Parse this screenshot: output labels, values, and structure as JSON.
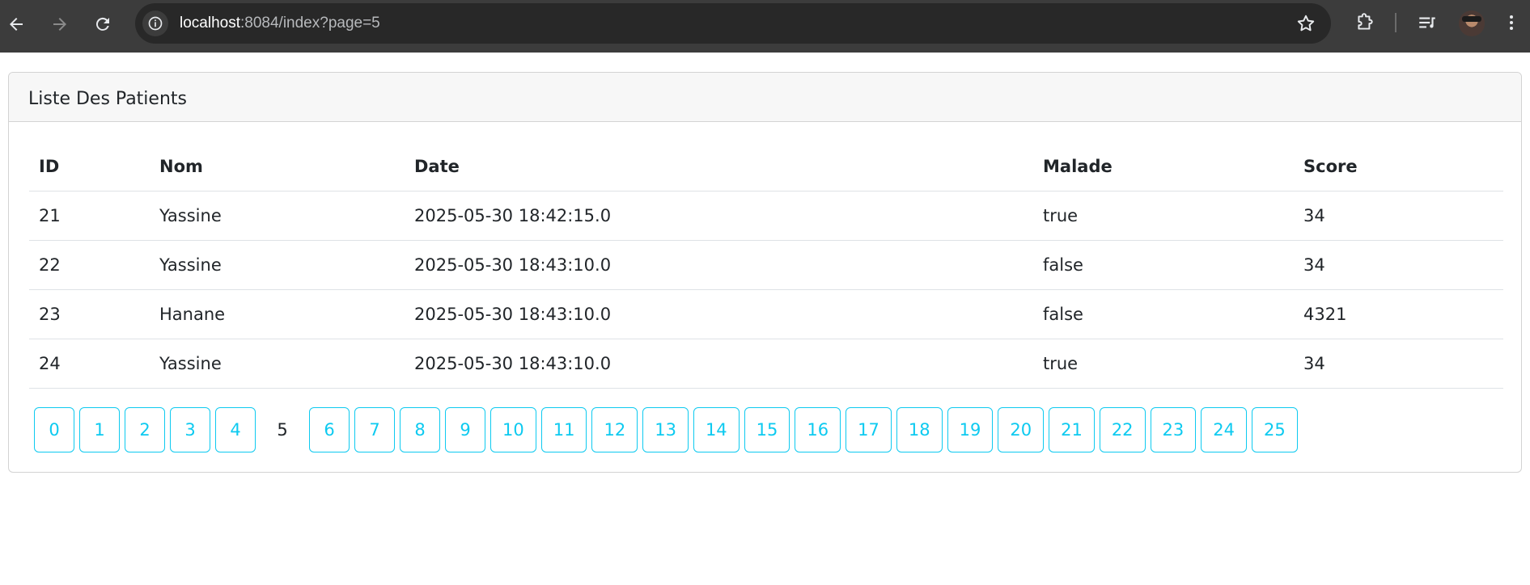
{
  "browser": {
    "url_host": "localhost",
    "url_path": ":8084/index?page=5"
  },
  "card": {
    "title": "Liste Des Patients"
  },
  "table": {
    "headers": [
      "ID",
      "Nom",
      "Date",
      "Malade",
      "Score"
    ],
    "rows": [
      [
        "21",
        "Yassine",
        "2025-05-30 18:42:15.0",
        "true",
        "34"
      ],
      [
        "22",
        "Yassine",
        "2025-05-30 18:43:10.0",
        "false",
        "34"
      ],
      [
        "23",
        "Hanane",
        "2025-05-30 18:43:10.0",
        "false",
        "4321"
      ],
      [
        "24",
        "Yassine",
        "2025-05-30 18:43:10.0",
        "true",
        "34"
      ]
    ]
  },
  "pagination": {
    "pages": [
      "0",
      "1",
      "2",
      "3",
      "4",
      "5",
      "6",
      "7",
      "8",
      "9",
      "10",
      "11",
      "12",
      "13",
      "14",
      "15",
      "16",
      "17",
      "18",
      "19",
      "20",
      "21",
      "22",
      "23",
      "24",
      "25"
    ],
    "current": "5"
  },
  "colors": {
    "accent": "#0dcaf0",
    "chrome_bg": "#3c3c3c"
  }
}
